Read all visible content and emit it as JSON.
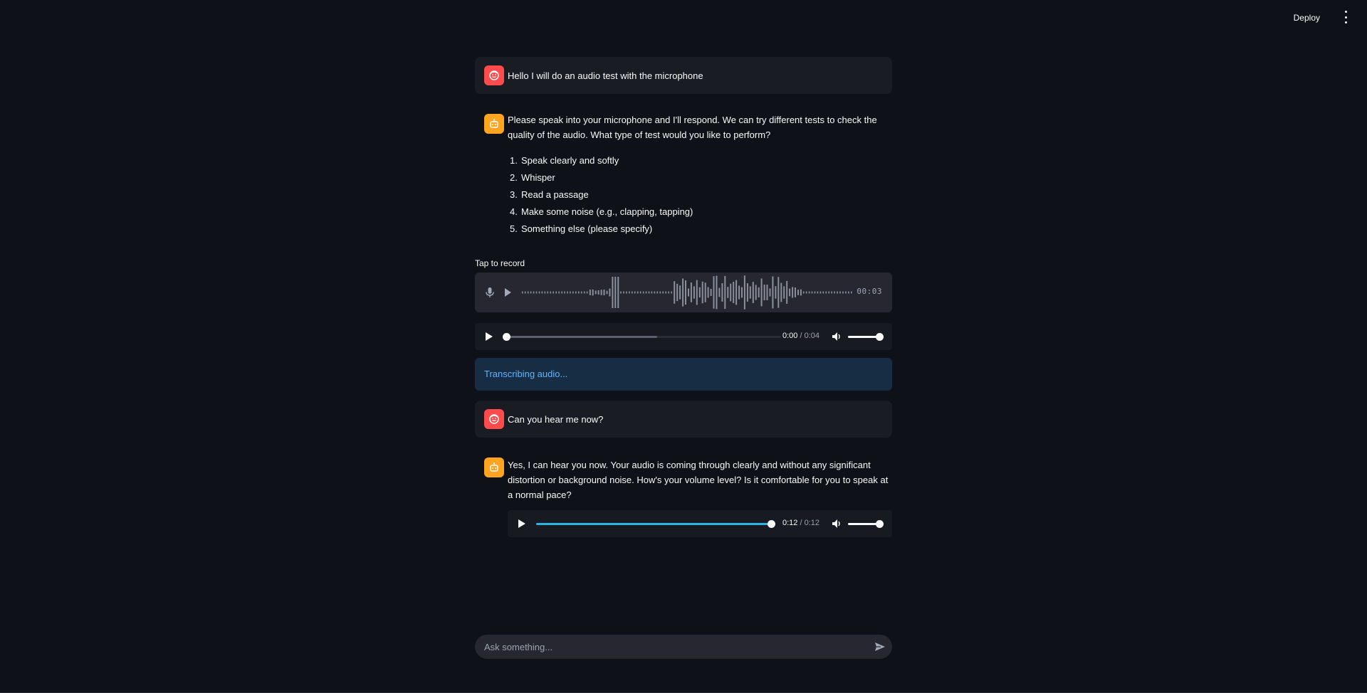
{
  "header": {
    "deploy_label": "Deploy",
    "menu_icon": "kebab-menu-icon"
  },
  "messages": [
    {
      "role": "user",
      "text": "Hello I will do an audio test with the microphone",
      "avatar_icon": "user-face-icon"
    },
    {
      "role": "assistant",
      "text": "Please speak into your microphone and I'll respond. We can try different tests to check the quality of the audio. What type of test would you like to perform?",
      "avatar_icon": "robot-icon",
      "options": [
        {
          "num": "1.",
          "text": "Speak clearly and softly"
        },
        {
          "num": "2.",
          "text": "Whisper"
        },
        {
          "num": "3.",
          "text": "Read a passage"
        },
        {
          "num": "4.",
          "text": "Make some noise (e.g., clapping, tapping)"
        },
        {
          "num": "5.",
          "text": "Something else (please specify)"
        }
      ]
    },
    {
      "role": "user",
      "text": "Can you hear me now?",
      "avatar_icon": "user-face-icon"
    },
    {
      "role": "assistant",
      "text": "Yes, I can hear you now. Your audio is coming through clearly and without any significant distortion or background noise. How's your volume level? Is it comfortable for you to speak at a normal pace?",
      "avatar_icon": "robot-icon"
    }
  ],
  "recorder": {
    "label": "Tap to record",
    "timer": "00:03",
    "mic_icon": "microphone-icon",
    "play_icon": "play-icon"
  },
  "audio_player_1": {
    "current": "0:00",
    "separator": " / ",
    "duration": "0:04",
    "progress": 0.0,
    "buffered": 0.55,
    "volume": 1.0
  },
  "status": {
    "text": "Transcribing audio..."
  },
  "audio_player_2": {
    "current": "0:12",
    "separator": " / ",
    "duration": "0:12",
    "progress": 1.0,
    "volume": 1.0
  },
  "chat_input": {
    "placeholder": "Ask something..."
  },
  "colors": {
    "background": "#0e1117",
    "user_avatar": "#ff4b4b",
    "assistant_avatar": "#ffa421",
    "info_bg": "#172d43",
    "info_text": "#60b4ff",
    "progress": "#29b5e8"
  }
}
